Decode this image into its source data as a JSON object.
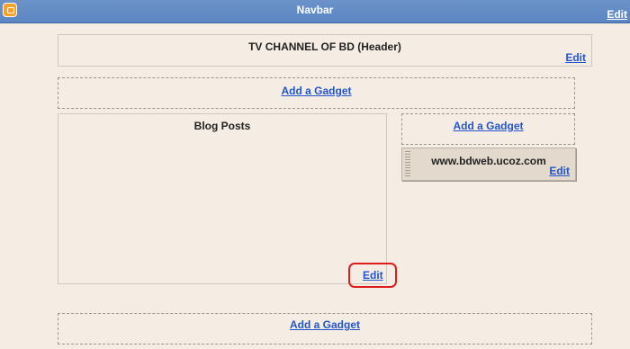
{
  "navbar": {
    "title": "Navbar",
    "edit_label": "Edit",
    "icon": "blogger-icon"
  },
  "header_widget": {
    "title": "TV CHANNEL OF BD (Header)",
    "edit_label": "Edit"
  },
  "add_gadget_top": {
    "label": "Add a Gadget"
  },
  "blog_posts": {
    "title": "Blog Posts",
    "edit_label": "Edit"
  },
  "sidebar": {
    "add_gadget_label": "Add a Gadget",
    "link_widget": {
      "title": "www.bdweb.ucoz.com",
      "edit_label": "Edit"
    }
  },
  "add_gadget_bottom": {
    "label": "Add a Gadget"
  },
  "colors": {
    "navbar": "#5c86c2",
    "background": "#f5ede3",
    "link": "#2255cc",
    "highlight": "#dd1c1c"
  }
}
